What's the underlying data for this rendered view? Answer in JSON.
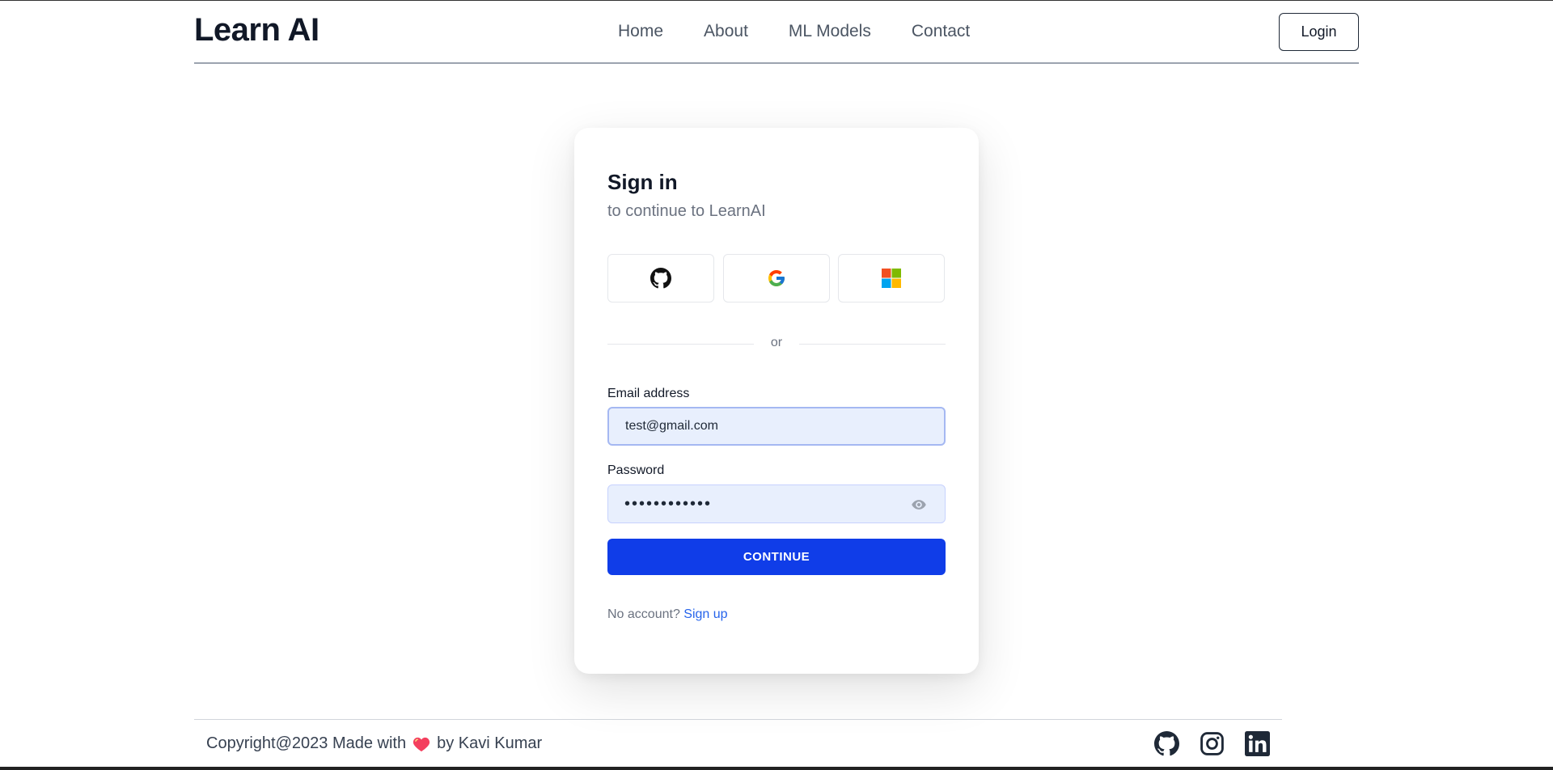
{
  "header": {
    "brand": "Learn AI",
    "nav": [
      "Home",
      "About",
      "ML Models",
      "Contact"
    ],
    "login_label": "Login"
  },
  "card": {
    "title": "Sign in",
    "subtitle": "to continue to LearnAI",
    "social_icons": [
      "github-icon",
      "google-icon",
      "microsoft-icon"
    ],
    "divider_text": "or",
    "email_label": "Email address",
    "email_value": "test@gmail.com",
    "password_label": "Password",
    "password_value": "••••••••••••",
    "continue_label": "CONTINUE",
    "no_account_text": "No account?",
    "signup_label": "Sign up"
  },
  "footer": {
    "text_before": "Copyright@2023 Made with",
    "text_after": "by Kavi Kumar",
    "heart_color": "#f43f5e",
    "icons": [
      "github-icon",
      "instagram-icon",
      "linkedin-icon"
    ]
  },
  "colors": {
    "primary": "#103de8",
    "input_bg": "#e8effd",
    "link": "#2563eb"
  }
}
